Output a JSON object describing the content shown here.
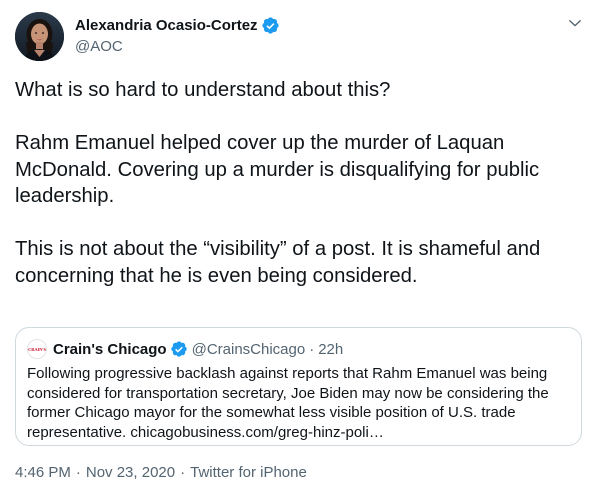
{
  "author": {
    "name": "Alexandria Ocasio-Cortez",
    "handle": "@AOC",
    "verified": true,
    "verified_color": "#1d9bf0"
  },
  "tweet": {
    "paragraphs": [
      "What is so hard to understand about this?",
      "Rahm Emanuel helped cover up the murder of Laquan McDonald. Covering up a murder is disqualifying for public leadership.",
      "This is not about the “visibility” of a post. It is shameful and concerning that he is even being considered."
    ]
  },
  "quoted_tweet": {
    "logo_text": "CRAIN'S",
    "name": "Crain's Chicago",
    "verified": true,
    "handle": "@CrainsChicago",
    "separator": "·",
    "time": "22h",
    "text": "Following progressive backlash against reports that Rahm Emanuel was being considered for transportation secretary, Joe Biden may now be considering the former Chicago mayor for the somewhat less visible position of U.S. trade representative. chicagobusiness.com/greg-hinz-poli…"
  },
  "meta": {
    "time": "4:46 PM",
    "separator": "·",
    "date": "Nov 23, 2020",
    "source": "Twitter for iPhone"
  },
  "icons": {
    "more": "chevron-down-icon",
    "verified": "verified-badge-icon"
  },
  "colors": {
    "text": "#0f1419",
    "secondary": "#536471",
    "border": "#cfd9de",
    "brand_red": "#c8102e"
  }
}
